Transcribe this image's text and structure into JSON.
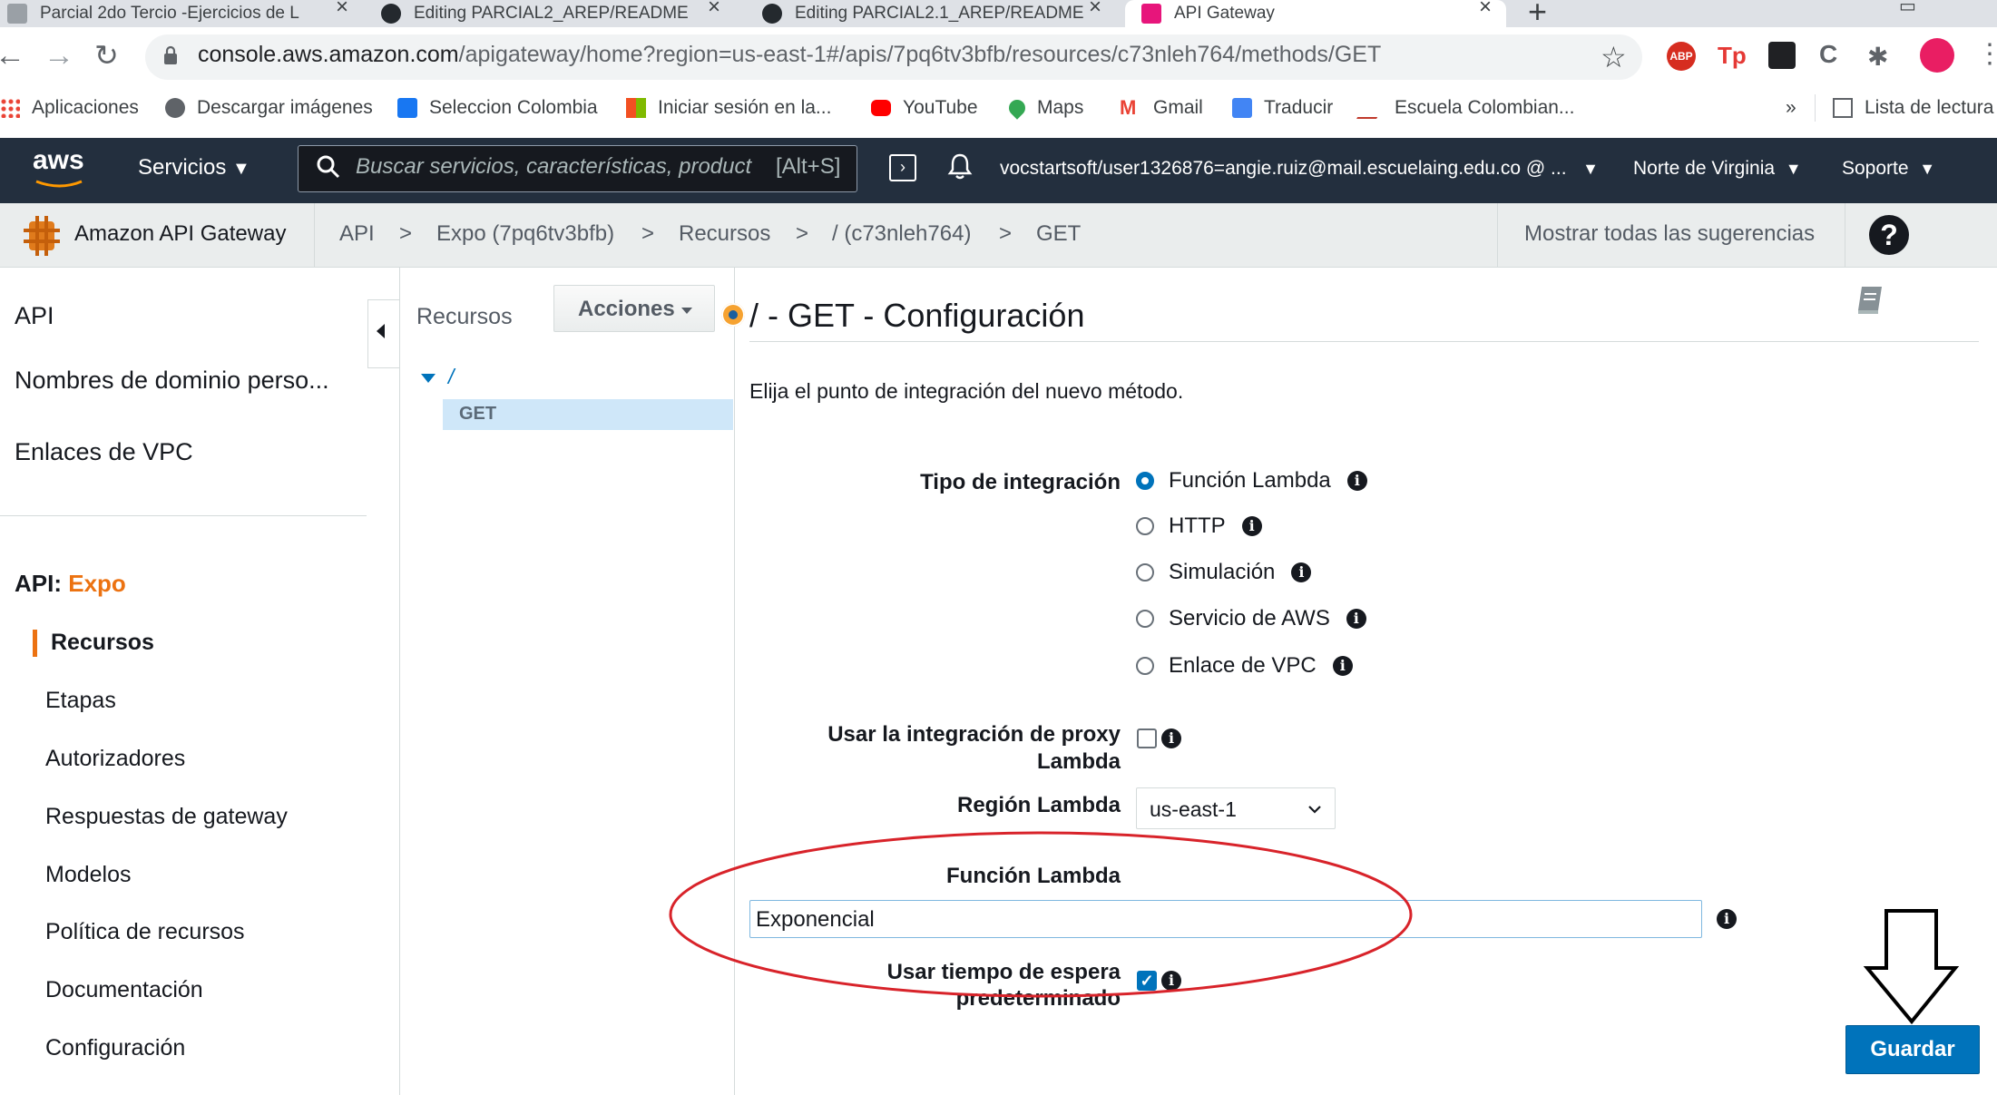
{
  "browser": {
    "tabs": [
      {
        "title": "Parcial 2do Tercio -Ejercicios de L"
      },
      {
        "title": "Editing PARCIAL2_AREP/README"
      },
      {
        "title": "Editing PARCIAL2.1_AREP/README"
      },
      {
        "title": "API Gateway"
      }
    ],
    "url_host": "console.aws.amazon.com",
    "url_path": "/apigateway/home?region=us-east-1#/apis/7pq6tv3bfb/resources/c73nleh764/methods/GET",
    "bookmarks": [
      {
        "label": "Aplicaciones"
      },
      {
        "label": "Descargar imágenes"
      },
      {
        "label": "Seleccion Colombia"
      },
      {
        "label": "Iniciar sesión en la..."
      },
      {
        "label": "YouTube"
      },
      {
        "label": "Maps"
      },
      {
        "label": "Gmail"
      },
      {
        "label": "Traducir"
      },
      {
        "label": "Escuela Colombian..."
      }
    ],
    "bookmarks_more": "»",
    "reading_list": "Lista de lectura",
    "extensions": [
      "ABP",
      "Tp"
    ]
  },
  "aws_nav": {
    "logo": "aws",
    "services": "Servicios",
    "search_placeholder": "Buscar servicios, características, product",
    "search_shortcut": "[Alt+S]",
    "account": "vocstartsoft/user1326876=angie.ruiz@mail.escuelaing.edu.co @ ...",
    "region": "Norte de Virginia",
    "support": "Soporte"
  },
  "breadcrumb": {
    "service": "Amazon API Gateway",
    "items": [
      "API",
      "Expo (7pq6tv3bfb)",
      "Recursos",
      "/ (c73nleh764)",
      "GET"
    ],
    "separator": ">",
    "show_tips": "Mostrar todas las sugerencias",
    "help": "?"
  },
  "sidebar": {
    "top_items": [
      "API",
      "Nombres de dominio perso...",
      "Enlaces de VPC"
    ],
    "api_prefix": "API:",
    "api_name": "Expo",
    "items": [
      "Recursos",
      "Etapas",
      "Autorizadores",
      "Respuestas de gateway",
      "Modelos",
      "Política de recursos",
      "Documentación",
      "Configuración"
    ]
  },
  "resources": {
    "title": "Recursos",
    "actions": "Acciones",
    "root": "/",
    "method": "GET"
  },
  "main": {
    "title": "/ - GET - Configuración",
    "intro": "Elija el punto de integración del nuevo método.",
    "integration_type_label": "Tipo de integración",
    "integration_options": [
      "Función Lambda",
      "HTTP",
      "Simulación",
      "Servicio de AWS",
      "Enlace de VPC"
    ],
    "proxy_label_1": "Usar la integración de proxy",
    "proxy_label_2": "Lambda",
    "region_label": "Región Lambda",
    "region_value": "us-east-1",
    "function_label": "Función Lambda",
    "function_value": "Exponencial",
    "timeout_label_1": "Usar tiempo de espera",
    "timeout_label_2": "predeterminado",
    "save": "Guardar"
  },
  "colors": {
    "aws_nav": "#232f3e",
    "aws_orange": "#ec7211",
    "primary_button": "#0073bb",
    "annotation_red": "#d8232a"
  }
}
